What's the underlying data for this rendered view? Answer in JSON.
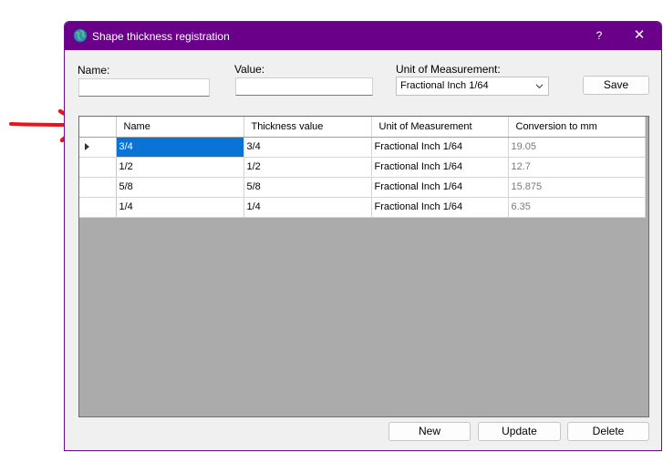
{
  "window": {
    "title": "Shape thickness registration",
    "help_label": "?",
    "close_label": "✕"
  },
  "form": {
    "name_label": "Name:",
    "name_value": "",
    "value_label": "Value:",
    "value_value": "",
    "unit_label": "Unit of Measurement:",
    "unit_selected": "Fractional Inch 1/64",
    "save_label": "Save"
  },
  "grid": {
    "columns": [
      "Name",
      "Thickness value",
      "Unit of Measurement",
      "Conversion to mm"
    ],
    "rows": [
      [
        "3/4",
        "3/4",
        "Fractional Inch 1/64",
        "19.05"
      ],
      [
        "1/2",
        "1/2",
        "Fractional Inch 1/64",
        "12.7"
      ],
      [
        "5/8",
        "5/8",
        "Fractional Inch 1/64",
        "15.875"
      ],
      [
        "1/4",
        "1/4",
        "Fractional Inch 1/64",
        "6.35"
      ]
    ],
    "selected_row": 0
  },
  "actions": {
    "new_label": "New",
    "update_label": "Update",
    "delete_label": "Delete"
  },
  "colors": {
    "titlebar": "#6a008a",
    "selection": "#0a74d6",
    "annotation_arrow": "#e8141b"
  },
  "icons": {
    "app": "globe-icon",
    "annotation": "red-arrow-icon"
  }
}
